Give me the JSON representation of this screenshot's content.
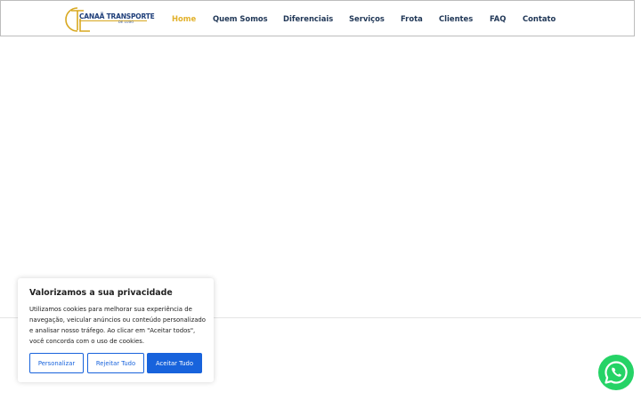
{
  "header": {
    "logo": {
      "monogram": "CTL",
      "name": "CANAÃ TRANSPORTE",
      "tagline": "DE LUXO"
    },
    "nav": [
      {
        "label": "Home",
        "active": true
      },
      {
        "label": "Quem Somos",
        "active": false
      },
      {
        "label": "Diferenciais",
        "active": false
      },
      {
        "label": "Serviços",
        "active": false
      },
      {
        "label": "Frota",
        "active": false
      },
      {
        "label": "Clientes",
        "active": false
      },
      {
        "label": "FAQ",
        "active": false
      },
      {
        "label": "Contato",
        "active": false
      }
    ]
  },
  "cookie_banner": {
    "title": "Valorizamos a sua privacidade",
    "text": "Utilizamos cookies para melhorar sua experiência de navegação, veicular anúncios ou conteúdo personalizado e analisar nosso tráfego. Ao clicar em \"Aceitar todos\", você concorda com o uso de cookies.",
    "buttons": {
      "customize": "Personalizar",
      "reject": "Rejeitar Tudo",
      "accept": "Aceitar Tudo"
    }
  },
  "whatsapp": {
    "icon": "whatsapp-icon"
  },
  "colors": {
    "nav_text": "#1f3656",
    "nav_active": "#e2b12b",
    "brand_blue": "#1863dc",
    "whatsapp_green": "#25d366"
  }
}
